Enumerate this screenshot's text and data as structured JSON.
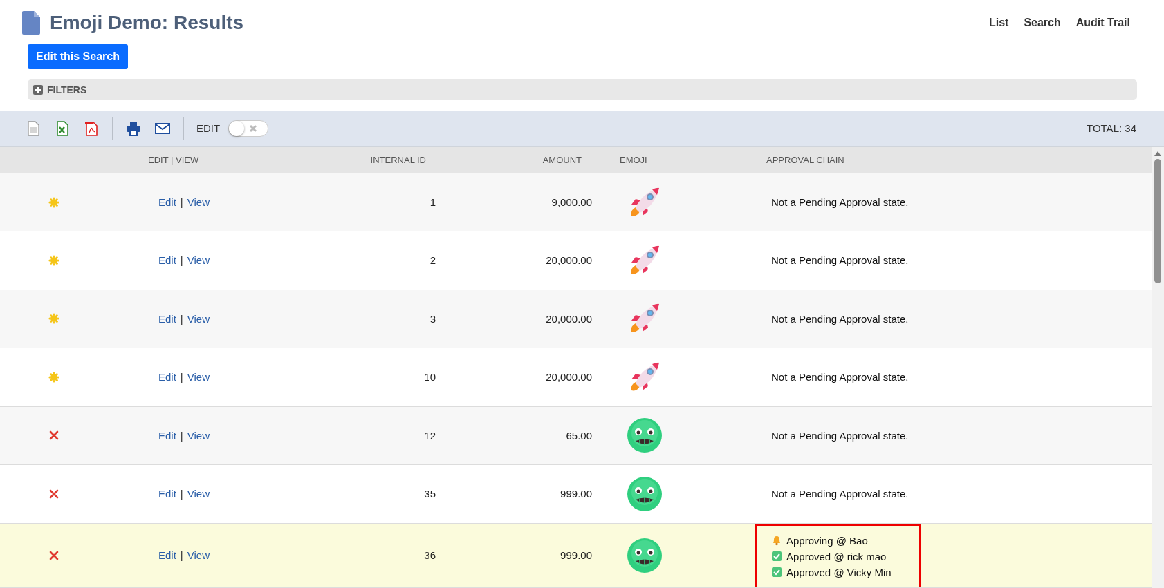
{
  "page": {
    "title": "Emoji Demo: Results",
    "nav_links": [
      "List",
      "Search",
      "Audit Trail"
    ],
    "edit_button": "Edit this Search"
  },
  "filters": {
    "label": "FILTERS",
    "expanded": false
  },
  "toolbar": {
    "edit_label": "EDIT",
    "edit_toggle": {
      "on": false
    },
    "total": "TOTAL: 34"
  },
  "table": {
    "columns": [
      "",
      "EDIT | VIEW",
      "INTERNAL ID",
      "AMOUNT",
      "EMOJI",
      "APPROVAL CHAIN"
    ],
    "rows": [
      {
        "status": {
          "kind": "sun"
        },
        "edit": "Edit",
        "separator": "|",
        "view": "View",
        "internal_id": "1",
        "amount": "9,000.00",
        "emoji": {
          "kind": "rocket"
        },
        "highlighted": false,
        "approval": [
          {
            "kind": "text",
            "text": "Not a Pending Approval state."
          }
        ]
      },
      {
        "status": {
          "kind": "sun"
        },
        "edit": "Edit",
        "separator": "|",
        "view": "View",
        "internal_id": "2",
        "amount": "20,000.00",
        "emoji": {
          "kind": "rocket"
        },
        "highlighted": false,
        "approval": [
          {
            "kind": "text",
            "text": "Not a Pending Approval state."
          }
        ]
      },
      {
        "status": {
          "kind": "sun"
        },
        "edit": "Edit",
        "separator": "|",
        "view": "View",
        "internal_id": "3",
        "amount": "20,000.00",
        "emoji": {
          "kind": "rocket"
        },
        "highlighted": false,
        "approval": [
          {
            "kind": "text",
            "text": "Not a Pending Approval state."
          }
        ]
      },
      {
        "status": {
          "kind": "sun"
        },
        "edit": "Edit",
        "separator": "|",
        "view": "View",
        "internal_id": "10",
        "amount": "20,000.00",
        "emoji": {
          "kind": "rocket"
        },
        "highlighted": false,
        "approval": [
          {
            "kind": "text",
            "text": "Not a Pending Approval state."
          }
        ]
      },
      {
        "status": {
          "kind": "cross"
        },
        "edit": "Edit",
        "separator": "|",
        "view": "View",
        "internal_id": "12",
        "amount": "65.00",
        "emoji": {
          "kind": "sick"
        },
        "highlighted": false,
        "approval": [
          {
            "kind": "text",
            "text": "Not a Pending Approval state."
          }
        ]
      },
      {
        "status": {
          "kind": "cross"
        },
        "edit": "Edit",
        "separator": "|",
        "view": "View",
        "internal_id": "35",
        "amount": "999.00",
        "emoji": {
          "kind": "sick"
        },
        "highlighted": false,
        "approval": [
          {
            "kind": "text",
            "text": "Not a Pending Approval state."
          }
        ]
      },
      {
        "status": {
          "kind": "cross"
        },
        "edit": "Edit",
        "separator": "|",
        "view": "View",
        "internal_id": "36",
        "amount": "999.00",
        "emoji": {
          "kind": "sick"
        },
        "highlighted": true,
        "framed": true,
        "approval": [
          {
            "kind": "bell",
            "text": "Approving @ Bao"
          },
          {
            "kind": "check",
            "text": "Approved @ rick mao"
          },
          {
            "kind": "check",
            "text": "Approved @ Vicky Min"
          }
        ]
      }
    ]
  }
}
